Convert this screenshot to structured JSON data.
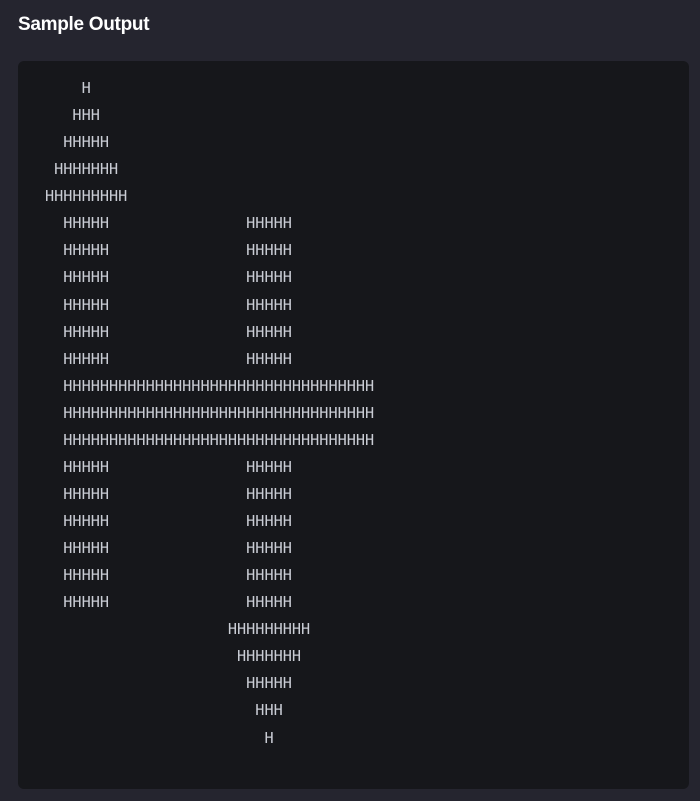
{
  "section": {
    "title": "Sample Output"
  },
  "output": {
    "lines": [
      "    H",
      "   HHH",
      "  HHHHH",
      " HHHHHHH",
      "HHHHHHHHH",
      "  HHHHH               HHHHH",
      "  HHHHH               HHHHH",
      "  HHHHH               HHHHH",
      "  HHHHH               HHHHH",
      "  HHHHH               HHHHH",
      "  HHHHH               HHHHH",
      "  HHHHHHHHHHHHHHHHHHHHHHHHHHHHHHHHHH",
      "  HHHHHHHHHHHHHHHHHHHHHHHHHHHHHHHHHH",
      "  HHHHHHHHHHHHHHHHHHHHHHHHHHHHHHHHHH",
      "  HHHHH               HHHHH",
      "  HHHHH               HHHHH",
      "  HHHHH               HHHHH",
      "  HHHHH               HHHHH",
      "  HHHHH               HHHHH",
      "  HHHHH               HHHHH",
      "                    HHHHHHHHH",
      "                     HHHHHHH",
      "                      HHHHH",
      "                       HHH",
      "                        H"
    ]
  }
}
